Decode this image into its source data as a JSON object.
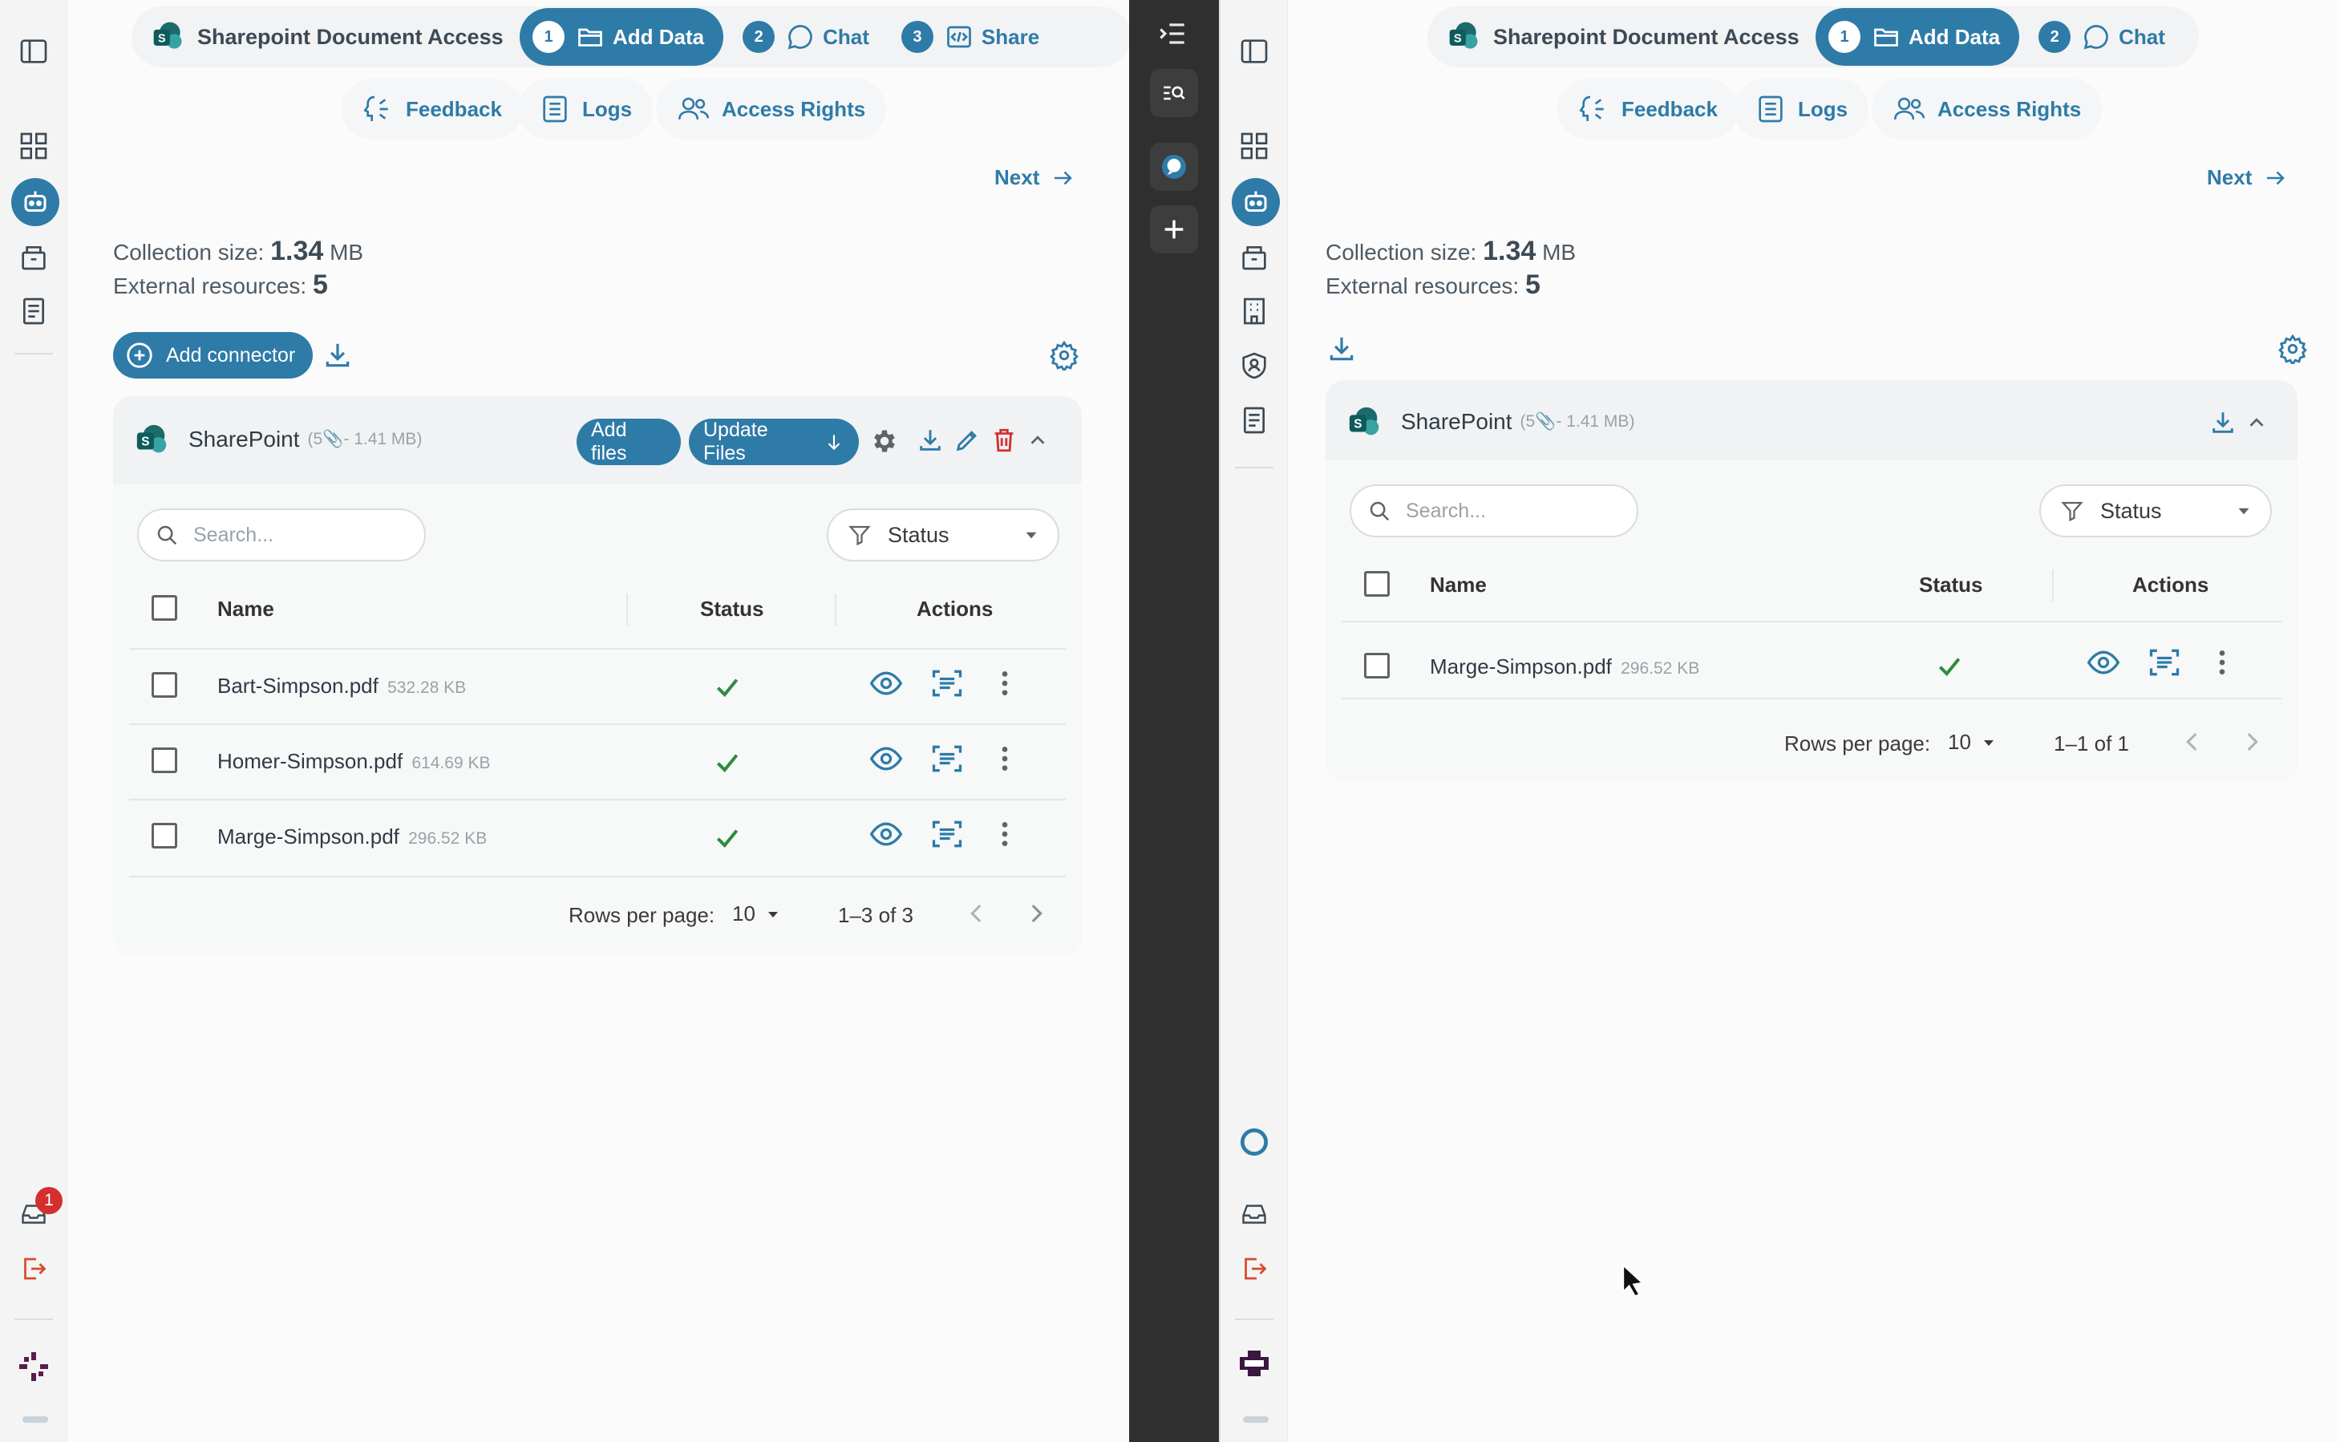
{
  "left": {
    "app_title": "Sharepoint Document Access",
    "steps": [
      {
        "num": "1",
        "label": "Add Data"
      },
      {
        "num": "2",
        "label": "Chat"
      },
      {
        "num": "3",
        "label": "Share"
      }
    ],
    "tabs": {
      "feedback": "Feedback",
      "logs": "Logs",
      "access": "Access Rights"
    },
    "next_label": "Next",
    "collection_label": "Collection size:",
    "collection_value": "1.34",
    "collection_unit": "MB",
    "external_label": "External resources:",
    "external_value": "5",
    "add_connector_label": "Add connector",
    "connector": {
      "name": "SharePoint",
      "count": "5",
      "size": "1.41 MB",
      "add_files_label": "Add files",
      "update_files_label": "Update Files"
    },
    "search_placeholder": "Search...",
    "status_filter_label": "Status",
    "columns": {
      "name": "Name",
      "status": "Status",
      "actions": "Actions"
    },
    "rows": [
      {
        "name": "Bart-Simpson.pdf",
        "size": "532.28 KB"
      },
      {
        "name": "Homer-Simpson.pdf",
        "size": "614.69 KB"
      },
      {
        "name": "Marge-Simpson.pdf",
        "size": "296.52 KB"
      }
    ],
    "rows_per_page_label": "Rows per page:",
    "rows_per_page_value": "10",
    "range": "1–3 of 3",
    "notification_count": "1"
  },
  "right": {
    "app_title": "Sharepoint Document Access",
    "steps": [
      {
        "num": "1",
        "label": "Add Data"
      },
      {
        "num": "2",
        "label": "Chat"
      }
    ],
    "tabs": {
      "feedback": "Feedback",
      "logs": "Logs",
      "access": "Access Rights"
    },
    "next_label": "Next",
    "collection_label": "Collection size:",
    "collection_value": "1.34",
    "collection_unit": "MB",
    "external_label": "External resources:",
    "external_value": "5",
    "connector": {
      "name": "SharePoint",
      "count": "5",
      "size": "1.41 MB"
    },
    "search_placeholder": "Search...",
    "status_filter_label": "Status",
    "columns": {
      "name": "Name",
      "status": "Status",
      "actions": "Actions"
    },
    "rows": [
      {
        "name": "Marge-Simpson.pdf",
        "size": "296.52 KB"
      }
    ],
    "rows_per_page_label": "Rows per page:",
    "rows_per_page_value": "10",
    "range": "1–1 of 1"
  },
  "colors": {
    "accent": "#2e7ba8",
    "success": "#2e8b3e",
    "danger": "#d32f2f",
    "dark_bar": "#2f2f2f"
  }
}
